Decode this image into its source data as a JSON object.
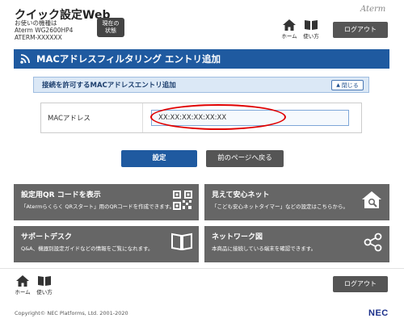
{
  "header": {
    "app_title": "クイック設定Web",
    "device_label": "お使いの機種は",
    "device_model": "Aterm WG2600HP4",
    "device_id": "ATERM-XXXXXX",
    "status_button_line1": "現在の",
    "status_button_line2": "状態",
    "brand": "Aterm",
    "home_label": "ホーム",
    "help_label": "使い方",
    "logout_label": "ログアウト"
  },
  "page": {
    "title": "MACアドレスフィルタリング エントリ追加",
    "title_icon": "wifi-icon"
  },
  "section": {
    "title": "接続を許可するMACアドレスエントリ追加",
    "close_label": "閉じる"
  },
  "form": {
    "mac_label": "MACアドレス",
    "mac_value": "XX:XX:XX:XX:XX:XX"
  },
  "actions": {
    "submit_label": "設定",
    "back_label": "前のページへ戻る"
  },
  "tiles": [
    {
      "title": "設定用QR コードを表示",
      "desc": "「Atermらくらく QRスタート」用のQRコードを作成できます。",
      "icon": "qr-code-icon"
    },
    {
      "title": "見えて安心ネット",
      "desc": "「こども安心ネットタイマー」などの設定はこちらから。",
      "icon": "home-search-icon"
    },
    {
      "title": "サポートデスク",
      "desc": "Q&A、機器別設定ガイドなどの情報をご覧になれます。",
      "icon": "book-icon"
    },
    {
      "title": "ネットワーク図",
      "desc": "本商品に接続している端末を確認できます。",
      "icon": "share-network-icon"
    }
  ],
  "footer": {
    "home_label": "ホーム",
    "help_label": "使い方",
    "logout_label": "ログアウト",
    "copyright": "Copyright© NEC Platforms, Ltd. 2001-2020",
    "nec_logo": "NEC"
  },
  "colors": {
    "primary": "#1f5aa0",
    "dark_button": "#555555",
    "tile": "#666666",
    "highlight": "#e00000"
  }
}
